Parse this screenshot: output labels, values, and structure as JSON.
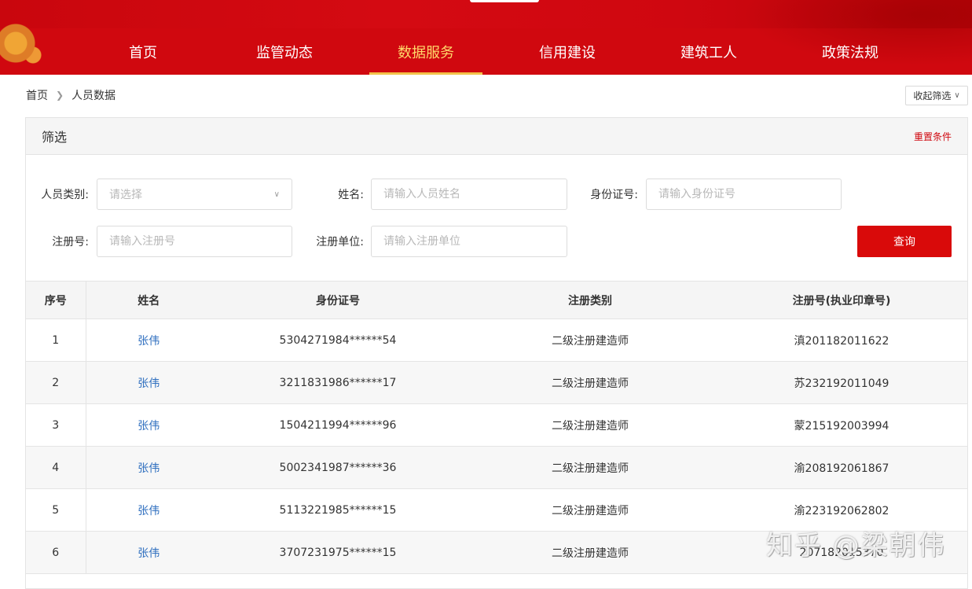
{
  "nav": {
    "items": [
      {
        "label": "首页"
      },
      {
        "label": "监管动态"
      },
      {
        "label": "数据服务",
        "active": true
      },
      {
        "label": "信用建设"
      },
      {
        "label": "建筑工人"
      },
      {
        "label": "政策法规"
      }
    ]
  },
  "breadcrumb": {
    "home": "首页",
    "current": "人员数据"
  },
  "collapse_filter": "收起筛选",
  "filter": {
    "title": "筛选",
    "reset": "重置条件",
    "person_type": {
      "label": "人员类别:",
      "placeholder": "请选择"
    },
    "name": {
      "label": "姓名:",
      "placeholder": "请输入人员姓名"
    },
    "id_card": {
      "label": "身份证号:",
      "placeholder": "请输入身份证号"
    },
    "reg_no": {
      "label": "注册号:",
      "placeholder": "请输入注册号"
    },
    "reg_unit": {
      "label": "注册单位:",
      "placeholder": "请输入注册单位"
    },
    "query": "查询"
  },
  "table": {
    "headers": [
      "序号",
      "姓名",
      "身份证号",
      "注册类别",
      "注册号(执业印章号)"
    ],
    "rows": [
      {
        "idx": "1",
        "name": "张伟",
        "id": "5304271984******54",
        "type": "二级注册建造师",
        "reg": "滇201182011622"
      },
      {
        "idx": "2",
        "name": "张伟",
        "id": "3211831986******17",
        "type": "二级注册建造师",
        "reg": "苏232192011049"
      },
      {
        "idx": "3",
        "name": "张伟",
        "id": "1504211994******96",
        "type": "二级注册建造师",
        "reg": "蒙215192003994"
      },
      {
        "idx": "4",
        "name": "张伟",
        "id": "5002341987******36",
        "type": "二级注册建造师",
        "reg": "渝208192061867"
      },
      {
        "idx": "5",
        "name": "张伟",
        "id": "5113221985******15",
        "type": "二级注册建造师",
        "reg": "渝223192062802"
      },
      {
        "idx": "6",
        "name": "张伟",
        "id": "3707231975******15",
        "type": "二级注册建造师",
        "reg": "207182015370"
      }
    ]
  },
  "watermark": "知乎 @梁朝伟",
  "colors": {
    "brand_red": "#d0080f",
    "active_nav": "#ffd86b",
    "link_blue": "#2f6fbf"
  }
}
